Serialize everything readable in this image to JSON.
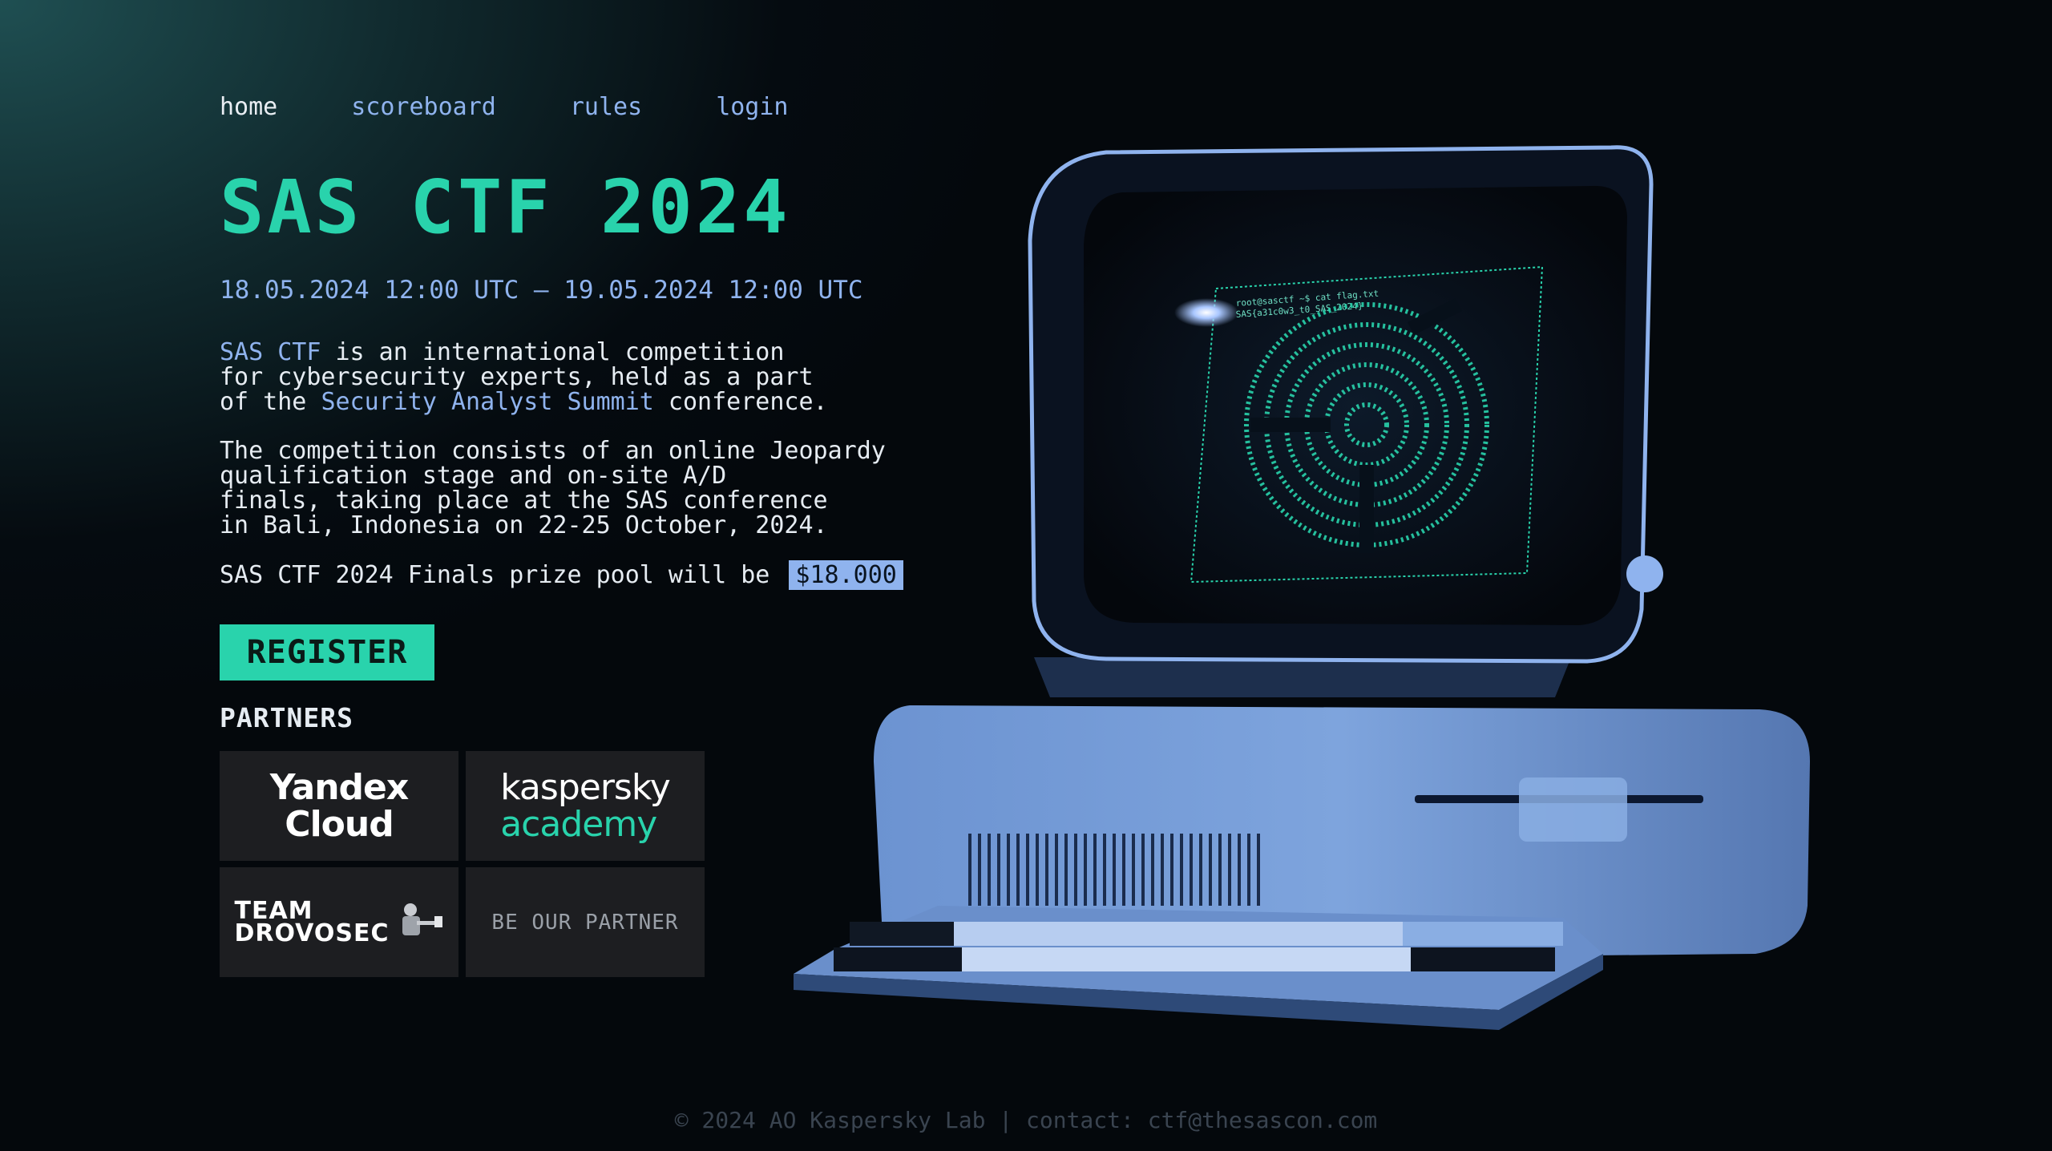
{
  "nav": {
    "home": "home",
    "scoreboard": "scoreboard",
    "rules": "rules",
    "login": "login"
  },
  "title": "SAS CTF 2024",
  "dates": "18.05.2024 12:00 UTC — 19.05.2024 12:00 UTC",
  "intro": {
    "highlight_1": "SAS CTF",
    "text_1": " is an international competition\nfor cybersecurity experts, held as a part\nof the ",
    "highlight_2": "Security Analyst Summit",
    "text_2": " conference."
  },
  "description": "The competition consists of an online Jeopardy\nqualification stage and on-site A/D\nfinals, taking place at the SAS conference\nin Bali, Indonesia on 22-25 October, 2024.",
  "prize": {
    "text": "SAS CTF 2024 Finals prize pool will be ",
    "amount": "$18.000"
  },
  "register_label": "REGISTER",
  "partners": {
    "label": "PARTNERS",
    "yandex": "Yandex\nCloud",
    "kaspersky_1": "kaspersky",
    "kaspersky_2": "academy",
    "drovosec": "TEAM\nDROVOSEC",
    "be_partner": "BE OUR PARTNER"
  },
  "screen_text": {
    "line1": "root@sasctf ~$ cat flag.txt",
    "line2": "SAS{a31c0w3_t0_SAS_2024}"
  },
  "footer": "© 2024 AO Kaspersky Lab | contact: ctf@thesascon.com",
  "colors": {
    "accent": "#29d3ac",
    "link": "#8fb3ee",
    "tile_bg": "#1d1e21"
  }
}
